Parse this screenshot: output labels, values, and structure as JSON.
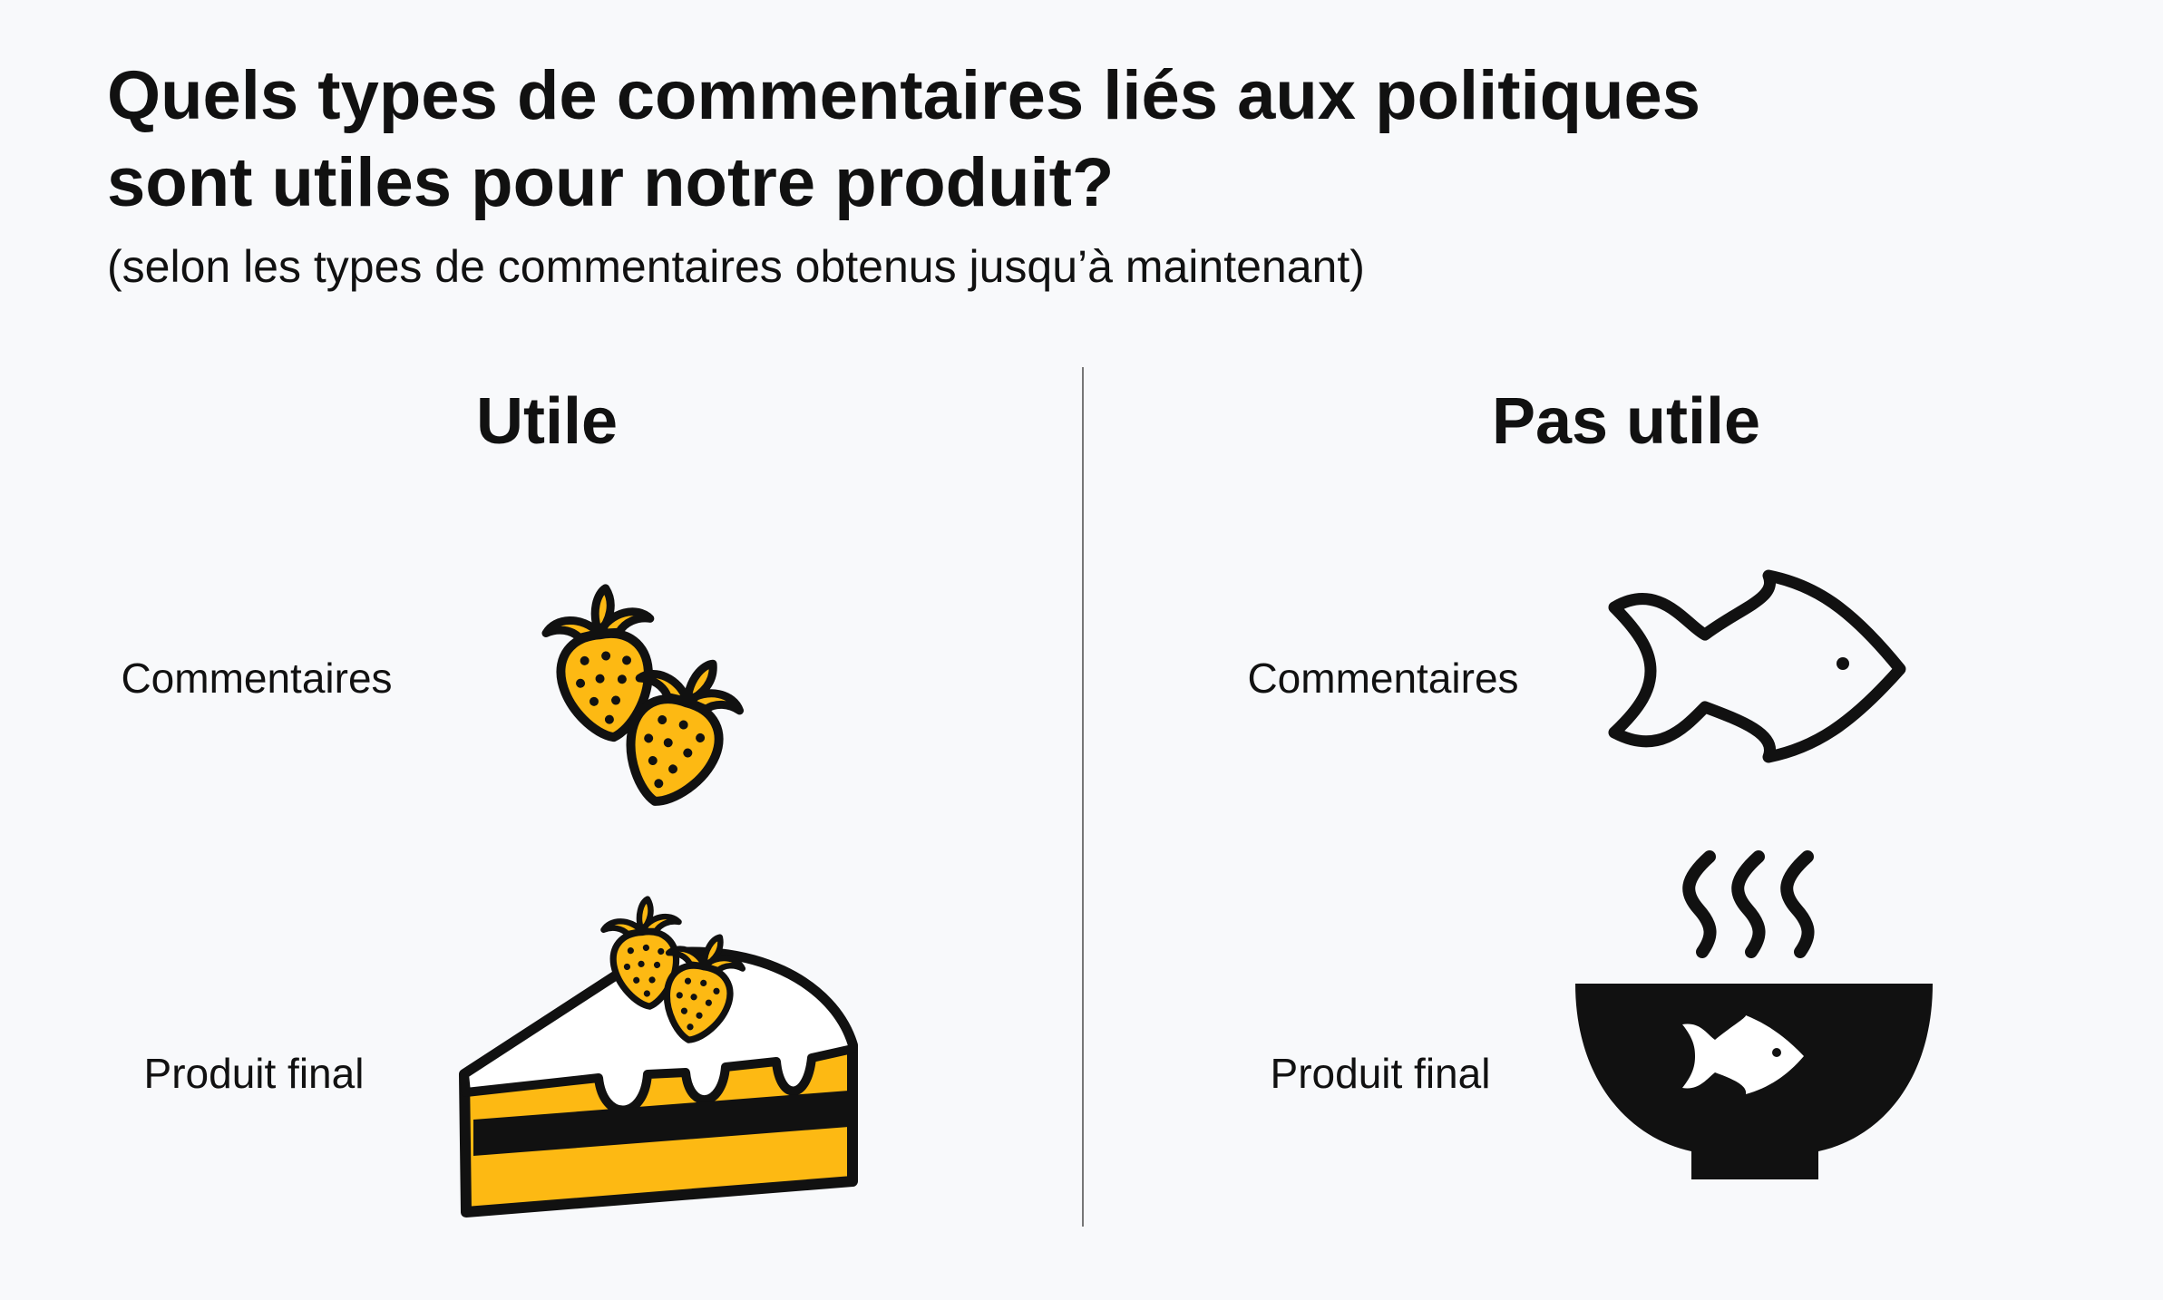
{
  "title": {
    "line1": "Quels types de commentaires liés aux politiques",
    "line2": "sont utiles pour notre produit?"
  },
  "subtitle": "(selon les types de commentaires obtenus jusqu’à maintenant)",
  "columns": {
    "useful": {
      "heading": "Utile",
      "feedback_label": "Commentaires",
      "product_label": "Produit final",
      "feedback_icon": "strawberries-icon",
      "product_icon": "strawberry-cake-icon"
    },
    "not_useful": {
      "heading": "Pas utile",
      "feedback_label": "Commentaires",
      "product_label": "Produit final",
      "feedback_icon": "fish-icon",
      "product_icon": "fish-soup-bowl-icon"
    }
  },
  "colors": {
    "accent_yellow": "#fdb913",
    "ink": "#111111",
    "background": "#f8f9fb",
    "divider": "#777777"
  }
}
